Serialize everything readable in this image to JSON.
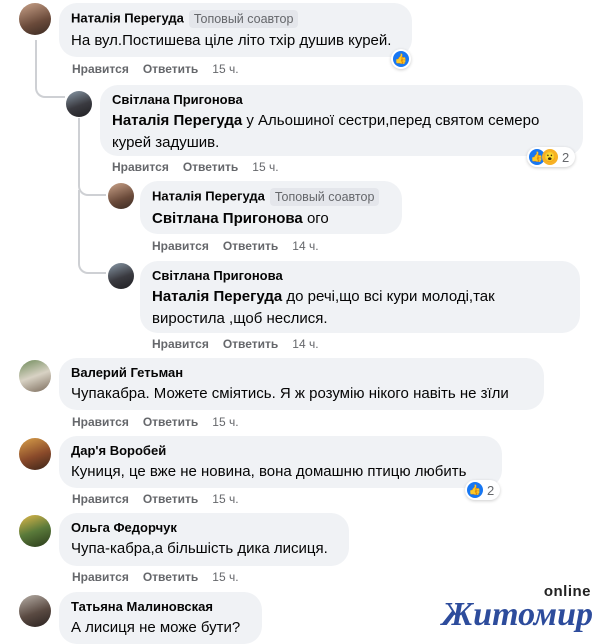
{
  "comments": [
    {
      "author": "Наталія Перегуда",
      "badge": "Топовый соавтор",
      "text": "На вул.Постишева ціле літо тхір душив курей.",
      "like": "Нравится",
      "reply": "Ответить",
      "time": "15 ч.",
      "reaction_count": ""
    },
    {
      "author": "Світлана Пригонова",
      "mention": "Наталія Перегуда",
      "text": " у Альошиної сестри,перед святом семеро курей задушив.",
      "like": "Нравится",
      "reply": "Ответить",
      "time": "15 ч.",
      "reaction_count": "2"
    },
    {
      "author": "Наталія Перегуда",
      "badge": "Топовый соавтор",
      "mention": "Світлана Пригонова",
      "text": " ого",
      "like": "Нравится",
      "reply": "Ответить",
      "time": "14 ч."
    },
    {
      "author": "Світлана Пригонова",
      "mention": "Наталія Перегуда",
      "text": " до речі,що всі кури молоді,так виростила ,щоб неслися.",
      "like": "Нравится",
      "reply": "Ответить",
      "time": "14 ч."
    },
    {
      "author": "Валерий Гетьман",
      "text": "Чупакабра. Можете сміятись. Я ж розумію нікого навіть не зїли",
      "like": "Нравится",
      "reply": "Ответить",
      "time": "15 ч."
    },
    {
      "author": "Дар'я Воробей",
      "text": "Куниця, це вже не новина, вона домашню птицю любить",
      "like": "Нравится",
      "reply": "Ответить",
      "time": "15 ч.",
      "reaction_count": "2"
    },
    {
      "author": "Ольга Федорчук",
      "text": "Чупа-кабра,а більшість дика лисиця.",
      "like": "Нравится",
      "reply": "Ответить",
      "time": "15 ч."
    },
    {
      "author": "Татьяна Малиновская",
      "text": "А лисиця не може бути?"
    }
  ],
  "logo": {
    "main": "Житомир",
    "sub": "online"
  },
  "colors": {
    "bubble": "#f0f2f5",
    "like_blue": "#1877f2",
    "meta_gray": "#65676b",
    "logo_blue": "#2d4c9c"
  }
}
